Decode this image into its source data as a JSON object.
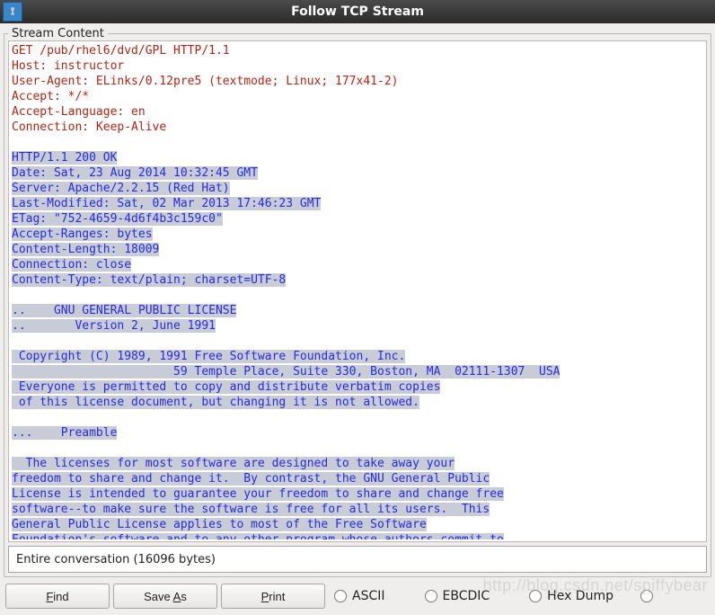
{
  "title": "Follow TCP Stream",
  "section_label": "Stream Content",
  "request_lines": [
    "GET /pub/rhel6/dvd/GPL HTTP/1.1",
    "Host: instructor",
    "User-Agent: ELinks/0.12pre5 (textmode; Linux; 177x41-2)",
    "Accept: */*",
    "Accept-Language: en",
    "Connection: Keep-Alive"
  ],
  "response_lines": [
    "HTTP/1.1 200 OK",
    "Date: Sat, 23 Aug 2014 10:32:45 GMT",
    "Server: Apache/2.2.15 (Red Hat)",
    "Last-Modified: Sat, 02 Mar 2013 17:46:23 GMT",
    "ETag: \"752-4659-4d6f4b3c159c0\"",
    "Accept-Ranges: bytes",
    "Content-Length: 18009",
    "Connection: close",
    "Content-Type: text/plain; charset=UTF-8",
    "",
    "..    GNU GENERAL PUBLIC LICENSE",
    "..       Version 2, June 1991",
    "",
    " Copyright (C) 1989, 1991 Free Software Foundation, Inc.",
    "                       59 Temple Place, Suite 330, Boston, MA  02111-1307  USA",
    " Everyone is permitted to copy and distribute verbatim copies",
    " of this license document, but changing it is not allowed.",
    "",
    "...    Preamble",
    "",
    "  The licenses for most software are designed to take away your",
    "freedom to share and change it.  By contrast, the GNU General Public",
    "License is intended to guarantee your freedom to share and change free",
    "software--to make sure the software is free for all its users.  This",
    "General Public License applies to most of the Free Software",
    "Foundation's software and to any other program whose authors commit to"
  ],
  "dropdown_value": "Entire conversation (16096 bytes)",
  "buttons": {
    "find": "Find",
    "saveas_pre": "Save ",
    "saveas_mn": "A",
    "saveas_post": "s",
    "print_mn": "P",
    "print_post": "rint"
  },
  "radios": {
    "ascii": "ASCII",
    "ebcdic": "EBCDIC",
    "hex": "Hex Dump"
  },
  "watermark": "http://blog.csdn.net/spiffybear"
}
